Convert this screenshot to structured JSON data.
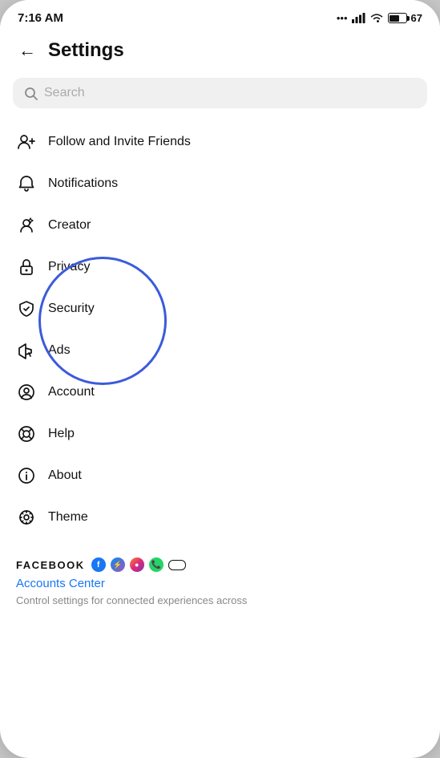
{
  "status": {
    "time": "7:16 AM",
    "battery_level": 67
  },
  "header": {
    "back_label": "←",
    "title": "Settings"
  },
  "search": {
    "placeholder": "Search"
  },
  "menu": {
    "items": [
      {
        "id": "follow-invite",
        "label": "Follow and Invite Friends",
        "icon": "follow-icon"
      },
      {
        "id": "notifications",
        "label": "Notifications",
        "icon": "bell-icon"
      },
      {
        "id": "creator",
        "label": "Creator",
        "icon": "creator-icon"
      },
      {
        "id": "privacy",
        "label": "Privacy",
        "icon": "lock-icon"
      },
      {
        "id": "security",
        "label": "Security",
        "icon": "shield-icon"
      },
      {
        "id": "ads",
        "label": "Ads",
        "icon": "ads-icon"
      },
      {
        "id": "account",
        "label": "Account",
        "icon": "account-icon"
      },
      {
        "id": "help",
        "label": "Help",
        "icon": "help-icon"
      },
      {
        "id": "about",
        "label": "About",
        "icon": "info-icon"
      },
      {
        "id": "theme",
        "label": "Theme",
        "icon": "theme-icon"
      }
    ]
  },
  "facebook_section": {
    "brand_label": "FACEBOOK",
    "accounts_center_link": "Accounts Center",
    "accounts_center_desc": "Control settings for connected experiences across"
  }
}
